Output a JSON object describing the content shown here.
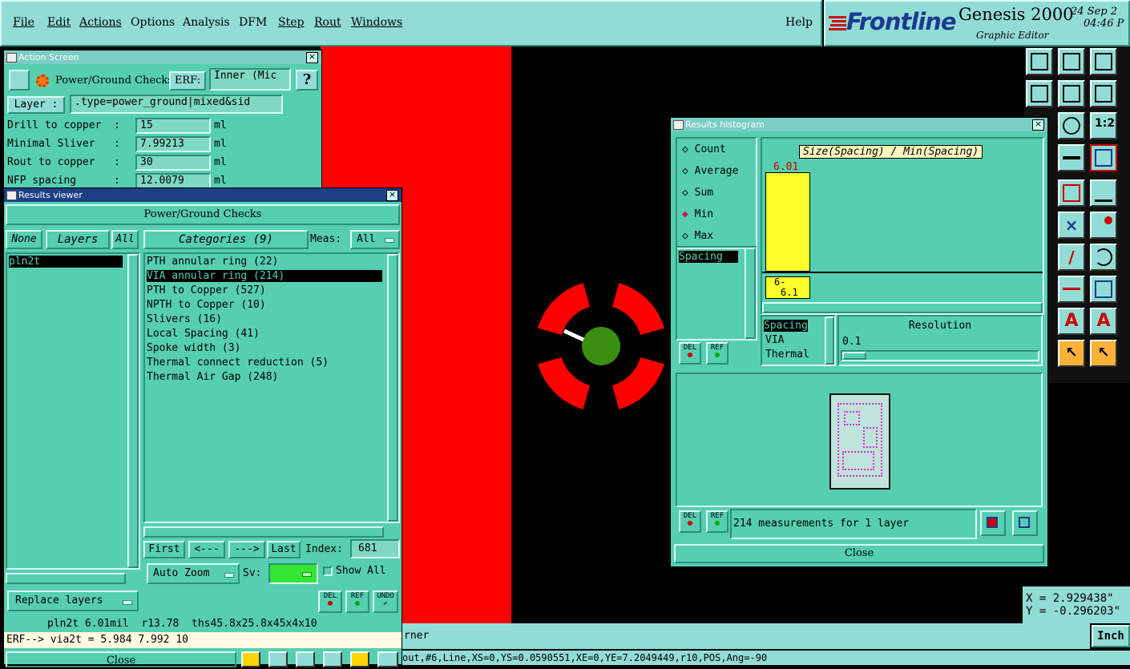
{
  "menu": {
    "items": [
      "File",
      "Edit",
      "Actions",
      "Options",
      "Analysis",
      "DFM",
      "Step",
      "Rout",
      "Windows"
    ],
    "help": "Help"
  },
  "brand": {
    "logo": "Frontline",
    "product": "Genesis 2000",
    "subtitle": "Graphic Editor",
    "date": "24 Sep 2",
    "time": "04:46 P"
  },
  "action_screen": {
    "title": "Action Screen",
    "check_name": "Power/Ground Checks",
    "erf_label": "ERF:",
    "erf_value": "Inner (Mic",
    "help_btn": "?",
    "layer_label": "Layer :",
    "layer_value": ".type=power_ground|mixed&sid",
    "params": [
      {
        "label": "Drill to copper  :",
        "value": "15",
        "unit": "ml"
      },
      {
        "label": "Minimal Sliver   :",
        "value": "7.99213",
        "unit": "ml"
      },
      {
        "label": "Rout to copper   :",
        "value": "30",
        "unit": "ml"
      },
      {
        "label": "NFP spacing      :",
        "value": "12.0079",
        "unit": "ml"
      }
    ]
  },
  "results_viewer": {
    "title": "Results viewer",
    "header": "Power/Ground Checks",
    "none_btn": "None",
    "layers_btn": "Layers",
    "all_btn": "All",
    "categories_btn": "Categories (9)",
    "meas_label": "Meas:",
    "meas_value": "All",
    "layers": [
      "pln2t"
    ],
    "categories": [
      "PTH annular ring (22)",
      "VIA annular ring (214)",
      "PTH to Copper (527)",
      "NPTH to Copper (10)",
      "Slivers (16)",
      "Local Spacing (41)",
      "Spoke width (3)",
      "Thermal connect reduction (5)",
      "Thermal Air Gap (248)"
    ],
    "selected_category": 1,
    "nav": {
      "first": "First",
      "prev": "<---",
      "next": "--->",
      "last": "Last",
      "index_label": "Index:",
      "index_value": "681"
    },
    "auto_zoom": "Auto Zoom",
    "sv_label": "Sv:",
    "show_all": "Show All",
    "replace_layers": "Replace layers",
    "del": "DEL",
    "ref": "REF",
    "undo": "UNDO",
    "status": "pln2t 6.01mil  r13.78  ths45.8x25.8x45x4x10",
    "erf_line": "ERF--> via2t = 5.984 7.992 10",
    "close": "Close"
  },
  "histogram": {
    "title": "Results histogram",
    "modes": [
      "Count",
      "Average",
      "Sum",
      "Min",
      "Max"
    ],
    "selected_mode": "Min",
    "chart_title": "Size(Spacing) / Min(Spacing)",
    "bar_value_label": "6.01",
    "bin_label_1": "6-",
    "bin_label_2": "6.1",
    "measure_list": [
      "Spacing"
    ],
    "type_list": [
      "Spacing",
      "VIA",
      "Thermal"
    ],
    "resolution_label": "Resolution",
    "resolution_value": "0.1",
    "del": "DEL",
    "ref": "REF",
    "status": "214 measurements for 1 layer",
    "close": "Close",
    "bar_color": "#ffff2a",
    "thumb_color": "#e02ae0"
  },
  "coords": {
    "x": "X = 2.929438\"",
    "y": "Y = -0.296203\"",
    "units_btn": "Inch"
  },
  "bottom": {
    "info_text": "rner",
    "feature_text": "out,#6,Line,XS=0,YS=0.0590551,XE=0,YE=7.2049449,r10,POS,Ang=-90"
  },
  "colors": {
    "panel": "#56cfb0",
    "copper_red": "#ff0000",
    "pad_green": "#3a8f12"
  }
}
